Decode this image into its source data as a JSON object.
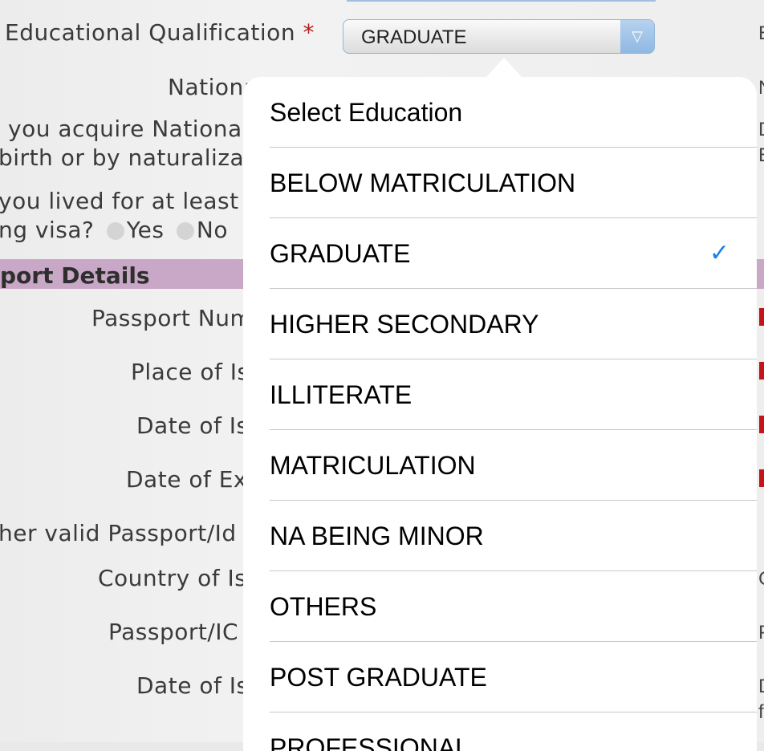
{
  "form": {
    "education_label": "Educational Qualification",
    "required_star": "*",
    "education_value": "GRADUATE",
    "dropdown_arrow": "▽",
    "nationality_label": "Nationa",
    "acquire_line1": "you acquire Nationa",
    "acquire_line2": "birth or by naturalizat",
    "lived_line1": "you lived for at least",
    "lived_line2": "ng visa?",
    "yes_label": "Yes",
    "no_label": "No",
    "section_title": "port Details",
    "passport_number_label": "Passport Num",
    "place_issue_label": "Place of Is",
    "date_issue_label": "Date of Is",
    "date_expiry_label": "Date of Ex",
    "other_passport_label": "her valid Passport/Id",
    "country_issue_label": "Country of Is",
    "passport_ic_label": "Passport/IC",
    "date_issue2_label": "Date of Is"
  },
  "edge_letters": [
    "E",
    "N",
    "D",
    "E",
    "C",
    "P",
    "D",
    "f"
  ],
  "popover": {
    "title": "Select Education",
    "options": [
      {
        "label": "BELOW MATRICULATION",
        "selected": false
      },
      {
        "label": "GRADUATE",
        "selected": true
      },
      {
        "label": "HIGHER SECONDARY",
        "selected": false
      },
      {
        "label": "ILLITERATE",
        "selected": false
      },
      {
        "label": "MATRICULATION",
        "selected": false
      },
      {
        "label": "NA BEING MINOR",
        "selected": false
      },
      {
        "label": "OTHERS",
        "selected": false
      },
      {
        "label": "POST GRADUATE",
        "selected": false
      },
      {
        "label": "PROFESSIONAL",
        "selected": false
      }
    ],
    "check_glyph": "✓",
    "check_color": "#1a7fe8"
  }
}
